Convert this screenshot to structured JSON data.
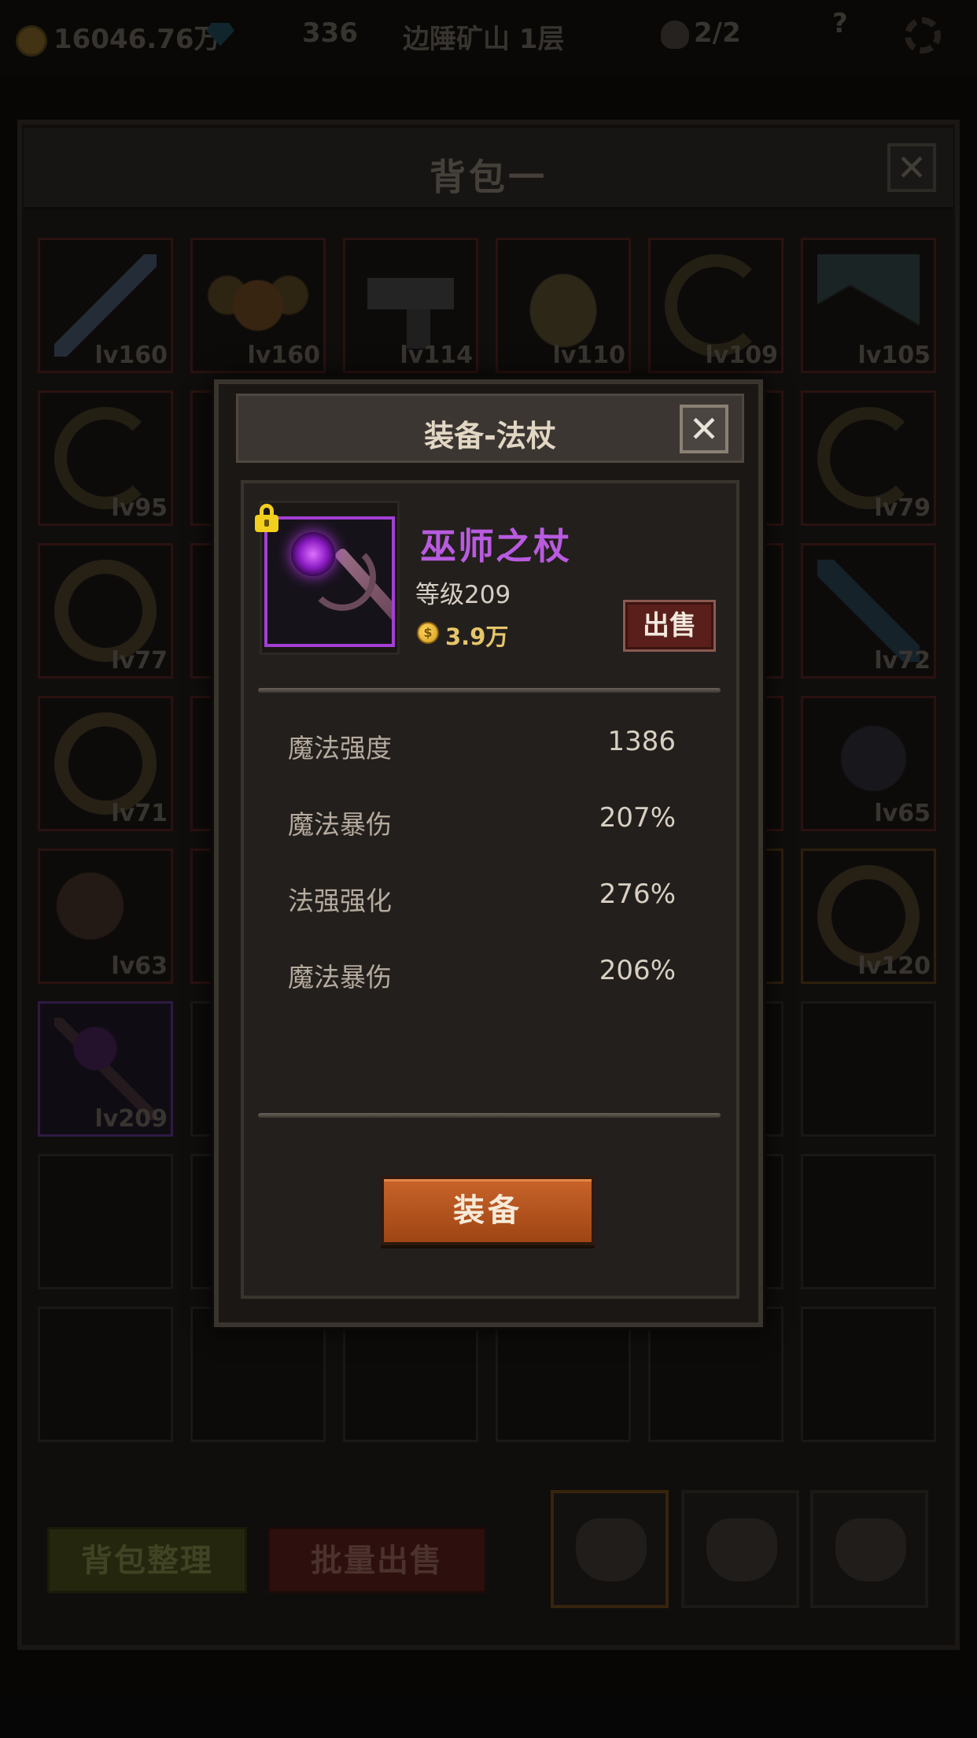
{
  "topbar": {
    "gold": "16046.76万",
    "gems": "336",
    "location": "边陲矿山 1层",
    "skull_count": "2/2",
    "help": "?"
  },
  "bag": {
    "title": "背包一",
    "close": "✕",
    "slots": [
      {
        "level": "lv160",
        "icon": "sword"
      },
      {
        "level": "lv160",
        "icon": "horned-helmet"
      },
      {
        "level": "lv114",
        "icon": "pistol"
      },
      {
        "level": "lv110",
        "icon": "goggles-cap"
      },
      {
        "level": "lv109",
        "icon": "curl-ring"
      },
      {
        "level": "lv105",
        "icon": "claw-blade"
      },
      {
        "level": "lv95",
        "icon": "curl-ring"
      },
      {
        "level": "lv79",
        "icon": "curl-ring"
      },
      {
        "level": "lv77",
        "icon": "gold-ring"
      },
      {
        "level": "lv72",
        "icon": "crystal-pendant"
      },
      {
        "level": "lv71",
        "icon": "gold-ring"
      },
      {
        "level": "lv65",
        "icon": "gauntlet"
      },
      {
        "level": "lv63",
        "icon": "axe"
      },
      {
        "level": "lv120",
        "icon": "eye-ring"
      },
      {
        "level": "lv209",
        "icon": "wizard-staff"
      }
    ],
    "sort_label": "背包整理",
    "bulk_sell_label": "批量出售"
  },
  "dialog": {
    "title": "装备-法杖",
    "close": "✕",
    "item": {
      "name": "巫师之杖",
      "level": "等级209",
      "price": "3.9万",
      "coin_symbol": "$",
      "name_color": "#b85bdf",
      "locked": true
    },
    "sell_label": "出售",
    "stats": [
      {
        "label": "魔法强度",
        "value": "1386"
      },
      {
        "label": "魔法暴伤",
        "value": "207%"
      },
      {
        "label": "法强强化",
        "value": "276%"
      },
      {
        "label": "魔法暴伤",
        "value": "206%"
      }
    ],
    "equip_label": "装备"
  }
}
